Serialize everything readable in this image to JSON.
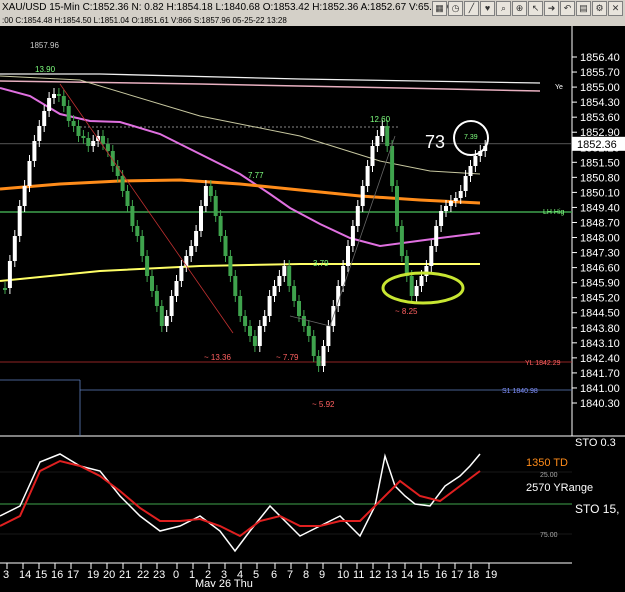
{
  "toolbar": {
    "title": "XAU/USD 15-Min  C:1852.36  N:  0.82  H:1854.18  L:1840.68  O:1853.42  H:1852.36  A:1852.67  V:65.4K  O:",
    "icons": [
      "grid-icon",
      "clock-icon",
      "line-icon",
      "heart-icon",
      "search-icon",
      "zoom-icon",
      "pointer-icon",
      "arrow-icon",
      "undo-icon",
      "chart-icon",
      "settings-icon",
      "close-icon"
    ]
  },
  "infobar": {
    "text": ":00  C:1854.48  H:1854.50  L:1851.04  O:1851.61  V:866  S:1857.96  05-25-22  13:28"
  },
  "price_axis": {
    "labels": [
      "1856.40",
      "1855.70",
      "1855.00",
      "1854.30",
      "1853.60",
      "1852.90",
      "1852.20",
      "1851.50",
      "1850.80",
      "1850.10",
      "1849.40",
      "1848.70",
      "1848.00",
      "1847.30",
      "1846.60",
      "1845.90",
      "1845.20",
      "1844.50",
      "1843.80",
      "1843.10",
      "1842.40",
      "1841.70",
      "1841.00",
      "1840.30"
    ],
    "current": "1852.36"
  },
  "annotations": {
    "top_left": "1857.96",
    "peak1": "13.90",
    "peak2": "12.60",
    "mid": "7.77",
    "small1": "3.79",
    "circle_val": "7.39",
    "big": "73",
    "low1": "~ 13.36",
    "low2": "~ 7.79",
    "low3": "~ 5.92",
    "low4": "~ 8.25",
    "yl": "YL 1842.29",
    "s1": "S1  1840.98",
    "lh": "LH Hig",
    "ye": "Ye"
  },
  "lower_panel": {
    "sto_top": "STO 0.3",
    "td": "1350 TD",
    "yrange": "2570 YRange",
    "sto": "STO  15,",
    "lvl25": "25.00",
    "lvl75": "75.00"
  },
  "x_axis": {
    "hours": [
      "3",
      "14",
      "15",
      "16",
      "17",
      "19",
      "20",
      "21",
      "22",
      "23",
      "0",
      "1",
      "2",
      "3",
      "4",
      "5",
      "6",
      "7",
      "8",
      "9",
      "10",
      "11",
      "12",
      "13",
      "14",
      "15",
      "16",
      "17",
      "18",
      "19"
    ],
    "date": "May 26 Thu"
  },
  "colors": {
    "up": "#ffffff",
    "down": "#3fa34d",
    "orange_ma": "#ff8c1a",
    "yellow_ma": "#ffff66",
    "magenta_ma": "#e070e0",
    "green_line": "#3fa34d",
    "ellipse": "#c8e632",
    "sto_white": "#ffffff",
    "sto_red": "#e02020"
  }
}
